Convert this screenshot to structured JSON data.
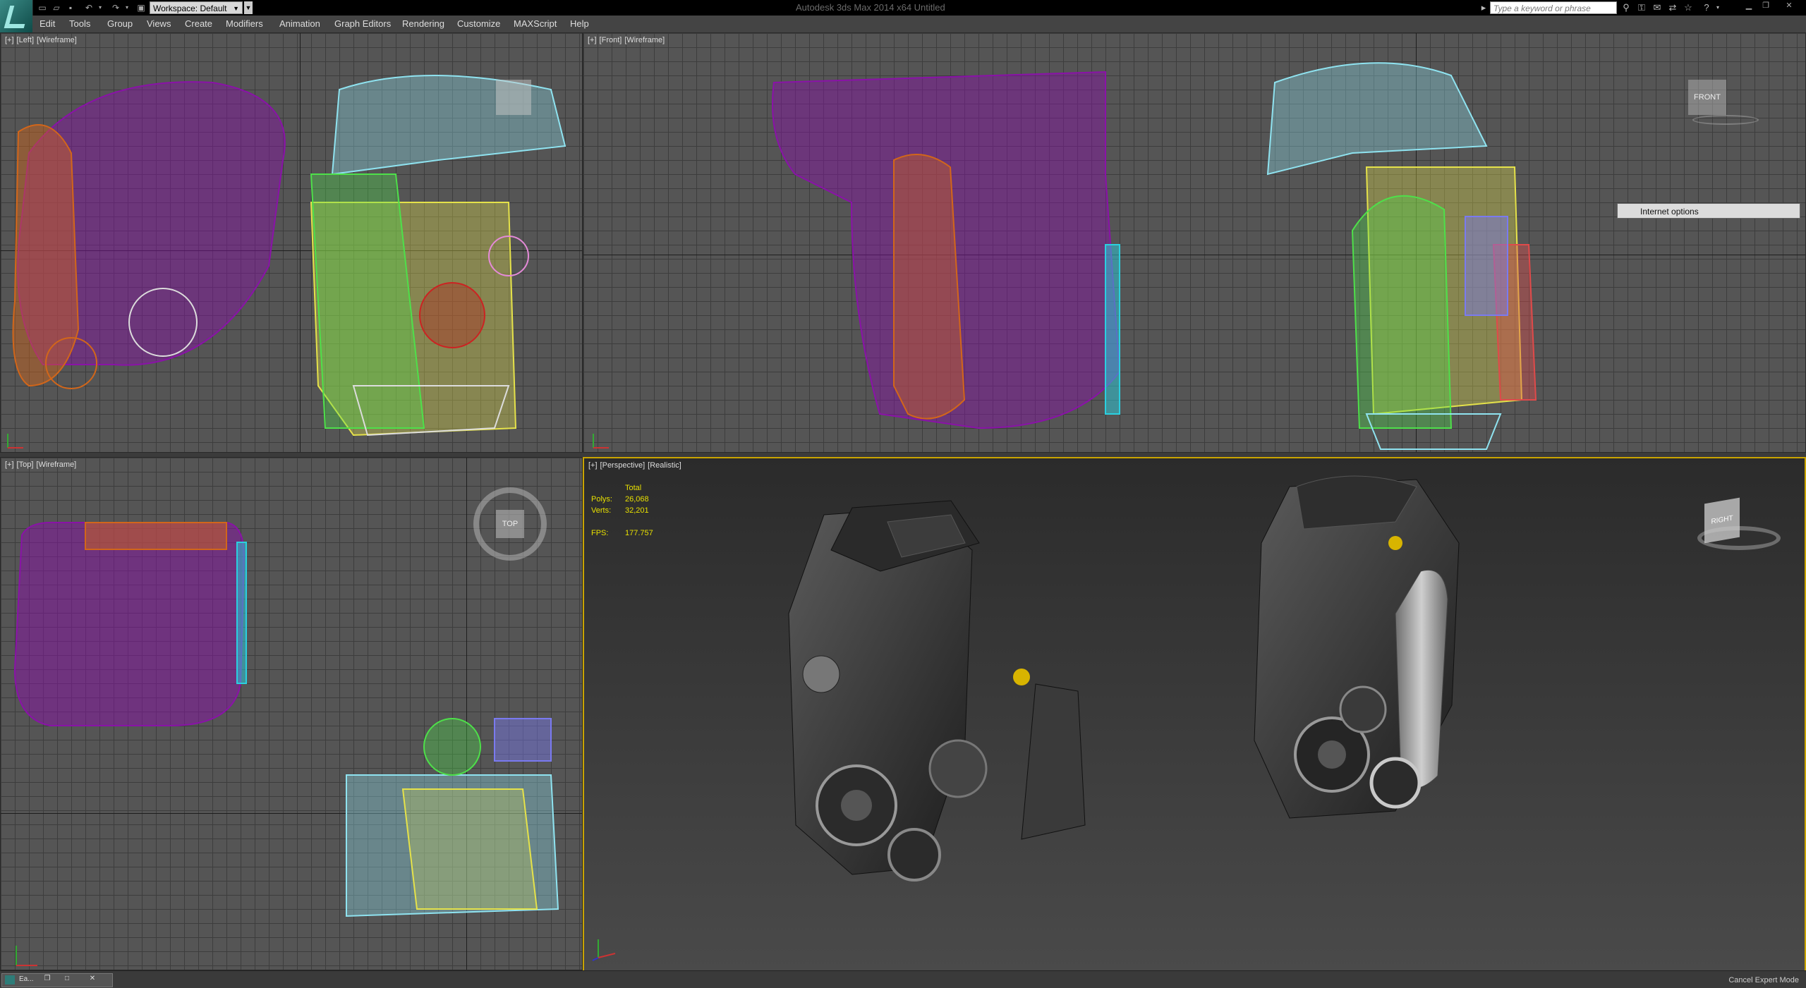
{
  "titlebar": {
    "workspace_label": "Workspace: Default",
    "doc_title": "Autodesk 3ds Max 2014 x64      Untitled",
    "search_placeholder": "Type a keyword or phrase"
  },
  "menu": [
    "Edit",
    "Tools",
    "Group",
    "Views",
    "Create",
    "Modifiers",
    "Animation",
    "Graph Editors",
    "Rendering",
    "Customize",
    "MAXScript",
    "Help"
  ],
  "viewports": {
    "left": {
      "plus": "[+]",
      "view": "[Left]",
      "mode": "[Wireframe]"
    },
    "front": {
      "plus": "[+]",
      "view": "[Front]",
      "mode": "[Wireframe]",
      "cube_label": "FRONT"
    },
    "top": {
      "plus": "[+]",
      "view": "[Top]",
      "mode": "[Wireframe]",
      "cube_label": "TOP"
    },
    "perspective": {
      "plus": "[+]",
      "view": "[Perspective]",
      "mode": "[Realistic]",
      "cube_label": "RIGHT"
    }
  },
  "stats": {
    "total_label": "Total",
    "polys_label": "Polys:",
    "polys_value": "26,068",
    "verts_label": "Verts:",
    "verts_value": "32,201",
    "fps_label": "FPS:",
    "fps_value": "177.757"
  },
  "context_menu": {
    "item": "Internet options"
  },
  "statusbar": {
    "cancel_expert": "Cancel Expert Mode",
    "task_label": "Ea..."
  },
  "colors": {
    "active_border": "#c9a400",
    "stats_text": "#e8e000",
    "wire_purple": "#8a12a8",
    "wire_cyan": "#8fe3f0",
    "wire_yellow": "#e5e24a",
    "wire_green": "#4ee04a",
    "wire_orange": "#d2661a"
  }
}
